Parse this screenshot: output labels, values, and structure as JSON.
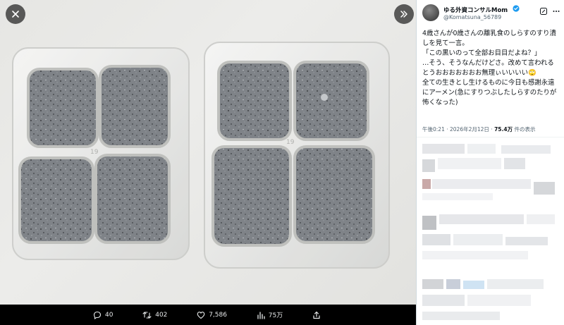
{
  "viewer": {
    "close_icon": "close-icon",
    "expand_icon": "double-chevron-right-icon",
    "photo_alt": "",
    "tray_number": "19",
    "actions": {
      "replies": "40",
      "reposts": "402",
      "likes": "7,586",
      "views": "75万"
    }
  },
  "post": {
    "display_name": "ゆる外資コンサルMom",
    "handle": "@Komatsuna_56789",
    "text_lines": [
      "4歳さんが0歳さんの離乳食のしらすのすり潰しを見て一言。",
      "「この黒いのって全部お目目だよね？」",
      "…そう、そうなんだけどさ。改めて言われるとうおおおおおおお無理ぃいいいい🙄",
      "全ての生きとし生けるものに今日も感謝永遠にアーメン(急にすりつぶしたしらすのたりが怖くなった)"
    ],
    "time": "午後0:21",
    "date": "2026年2月12日",
    "views_count": "75.4万",
    "views_label": "件の表示"
  },
  "colors": {
    "verified": "#1d9bf0",
    "panel_bg": "#ffffff",
    "viewer_bg": "#000000"
  }
}
